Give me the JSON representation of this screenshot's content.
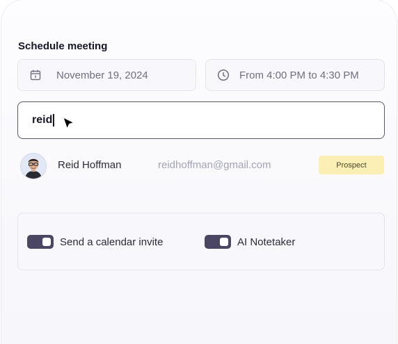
{
  "schedule": {
    "title": "Schedule meeting",
    "date_value": "November 19, 2024",
    "time_value": "From 4:00 PM to 4:30 PM"
  },
  "search": {
    "value": "reid"
  },
  "result": {
    "name": "Reid Hoffman",
    "email": "reidhoffman@gmail.com",
    "badge": "Prospect"
  },
  "options": {
    "calendar_invite_label": "Send a calendar invite",
    "calendar_invite_on": true,
    "notetaker_label": "AI Notetaker",
    "notetaker_on": true
  },
  "icons": {
    "date": "calendar-icon",
    "time": "clock-icon",
    "pointer": "mouse-pointer-icon"
  }
}
